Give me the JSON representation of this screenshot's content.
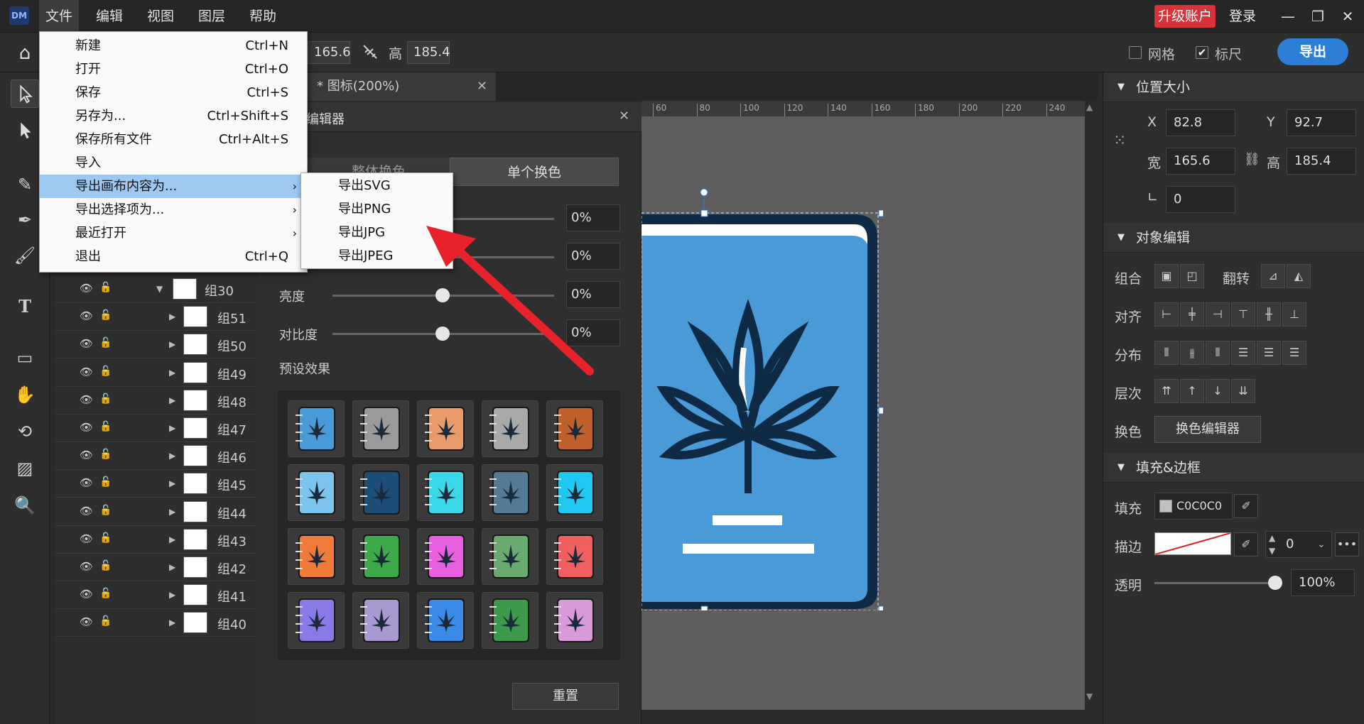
{
  "app": {
    "logo": "DM"
  },
  "menubar": {
    "items": [
      "文件",
      "编辑",
      "视图",
      "图层",
      "帮助"
    ]
  },
  "topright": {
    "upgrade": "升级账户",
    "login": "登录"
  },
  "toolbar": {
    "width_value": "165.6",
    "height_label": "高",
    "height_value": "185.4",
    "grid_label": "网格",
    "ruler_label": "标尺",
    "export_label": "导出",
    "grid_checked": false,
    "ruler_checked": true
  },
  "file_menu": {
    "items": [
      {
        "label": "新建",
        "shortcut": "Ctrl+N"
      },
      {
        "label": "打开",
        "shortcut": "Ctrl+O"
      },
      {
        "label": "保存",
        "shortcut": "Ctrl+S"
      },
      {
        "label": "另存为...",
        "shortcut": "Ctrl+Shift+S"
      },
      {
        "label": "保存所有文件",
        "shortcut": "Ctrl+Alt+S"
      },
      {
        "label": "导入",
        "shortcut": ""
      },
      {
        "label": "导出画布内容为...",
        "shortcut": "",
        "submenu": true,
        "highlighted": true
      },
      {
        "label": "导出选择项为...",
        "shortcut": "",
        "submenu": true
      },
      {
        "label": "最近打开",
        "shortcut": "",
        "submenu": true
      },
      {
        "label": "退出",
        "shortcut": "Ctrl+Q"
      }
    ]
  },
  "export_submenu": {
    "items": [
      "导出SVG",
      "导出PNG",
      "导出JPG",
      "导出JPEG"
    ]
  },
  "document_tab": {
    "title": "* 图标(200%)"
  },
  "color_editor": {
    "title_partial": "编辑器",
    "tab_whole": "整体换色",
    "tab_single": "单个换色",
    "sliders": [
      {
        "label": "",
        "value": "0%"
      },
      {
        "label": "",
        "value": "0%"
      },
      {
        "label": "亮度",
        "value": "0%"
      },
      {
        "label": "对比度",
        "value": "0%"
      }
    ],
    "presets_label": "预设效果",
    "reset_label": "重置",
    "preset_colors": [
      "#4a9ad8",
      "#9a9a9a",
      "#e89a6a",
      "#a8a8a8",
      "#c0602a",
      "#7cc4ec",
      "#1d4e78",
      "#3ad8e8",
      "#557a96",
      "#1ec8f0",
      "#f07a3a",
      "#3caa4a",
      "#e860e0",
      "#6aaa70",
      "#f06060",
      "#8a7ae8",
      "#a89ad0",
      "#3a8ae8",
      "#3c9a4a",
      "#d89ad8"
    ]
  },
  "layers": [
    {
      "name": "组30",
      "expanded": true
    },
    {
      "name": "组51"
    },
    {
      "name": "组50"
    },
    {
      "name": "组49"
    },
    {
      "name": "组48"
    },
    {
      "name": "组47"
    },
    {
      "name": "组46"
    },
    {
      "name": "组45"
    },
    {
      "name": "组44"
    },
    {
      "name": "组43"
    },
    {
      "name": "组42"
    },
    {
      "name": "组41"
    },
    {
      "name": "组40"
    }
  ],
  "ruler_ticks": [
    "60",
    "80",
    "100",
    "120",
    "140",
    "160",
    "180",
    "200",
    "220",
    "240"
  ],
  "right_panel": {
    "section_position": "位置大小",
    "x_label": "X",
    "x_value": "82.8",
    "y_label": "Y",
    "y_value": "92.7",
    "w_label": "宽",
    "w_value": "165.6",
    "h_label": "高",
    "h_value": "185.4",
    "angle_value": "0",
    "section_object": "对象编辑",
    "group_label": "组合",
    "flip_label": "翻转",
    "align_label": "对齐",
    "distribute_label": "分布",
    "layer_label": "层次",
    "recolor_label": "换色",
    "recolor_button": "换色编辑器",
    "section_fill": "填充&边框",
    "fill_label": "填充",
    "fill_value": "C0C0C0",
    "stroke_label": "描边",
    "stroke_width": "0",
    "opacity_label": "透明",
    "opacity_value": "100%"
  },
  "colors": {
    "accent": "#2d7fd6",
    "upgrade": "#d8323a",
    "menu_highlight": "#9dc8f0",
    "icon_blue": "#4a9ad8",
    "icon_dark": "#0f2a44"
  }
}
